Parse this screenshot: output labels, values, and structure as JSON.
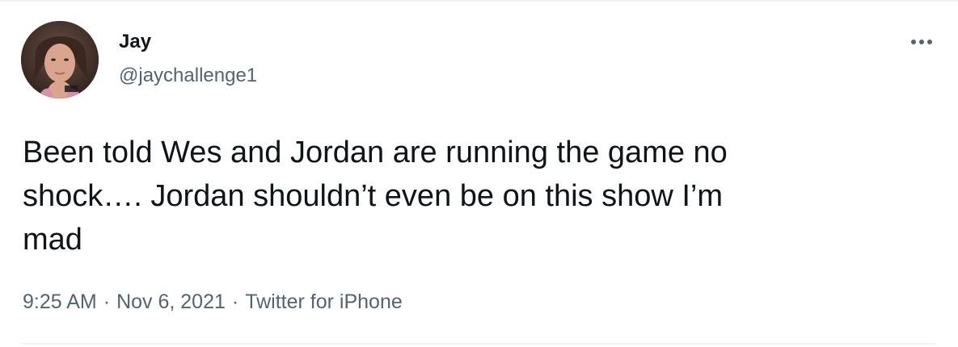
{
  "author": {
    "display_name": "Jay",
    "handle": "@jaychallenge1",
    "avatar_icon": "profile-photo"
  },
  "more_icon": "more-horizontal-icon",
  "tweet": {
    "lines": [
      "Been told Wes and Jordan are running the game no",
      "shock…. Jordan shouldn’t even be on this show I’m",
      "mad"
    ]
  },
  "meta": {
    "time": "9:25 AM",
    "separator": "·",
    "date": "Nov 6, 2021",
    "source": "Twitter for iPhone"
  },
  "colors": {
    "text_primary": "#0f1419",
    "text_secondary": "#536471",
    "divider": "#eff3f4"
  }
}
